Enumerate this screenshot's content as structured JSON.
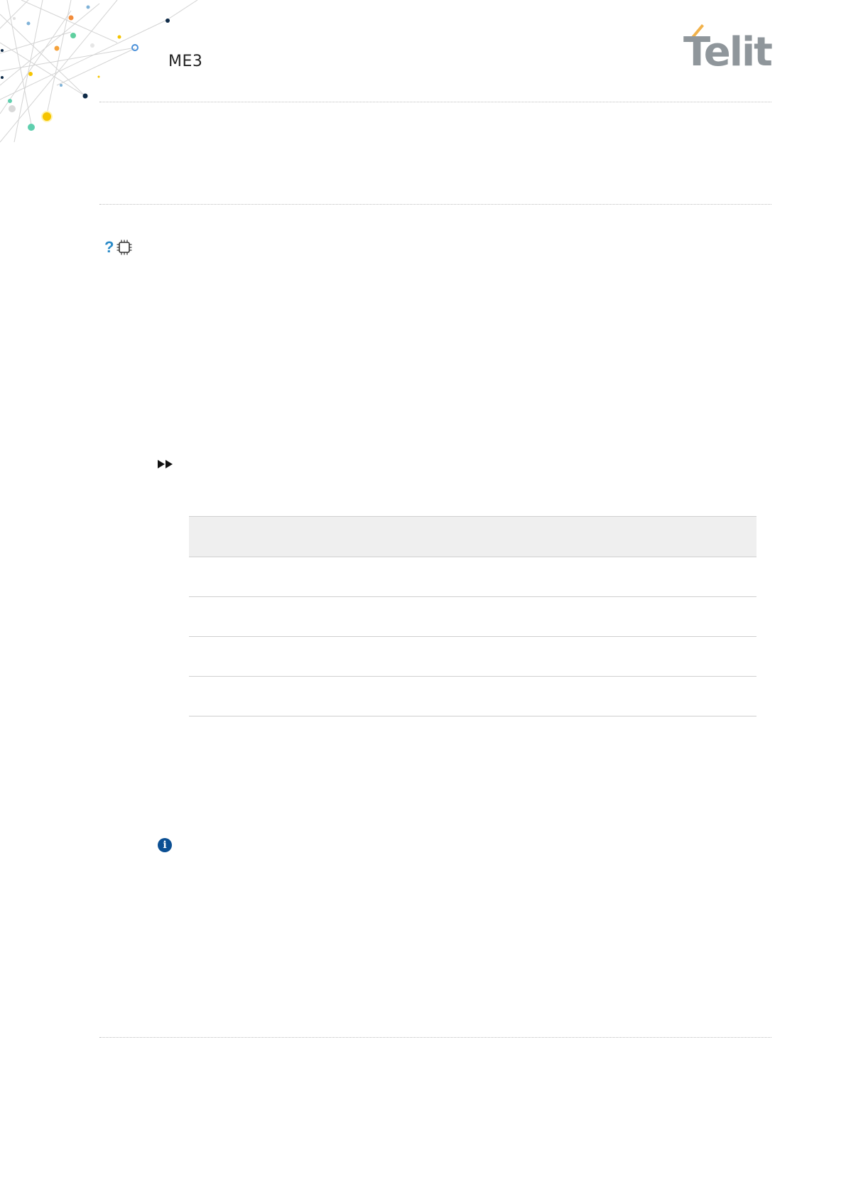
{
  "header": {
    "document_title": "ME3",
    "logo_text": "Telit"
  },
  "icons": {
    "help": "?",
    "chip": "chip-icon",
    "fast_forward": "fast-forward-icon",
    "info": "i"
  },
  "colors": {
    "logo_gray": "#8f969b",
    "logo_accent": "#f2b24b",
    "help_blue": "#2a8ac8",
    "info_blue": "#0b4f93",
    "table_header_bg": "#efefef"
  },
  "table": {
    "rows": [
      {},
      {},
      {},
      {}
    ]
  }
}
